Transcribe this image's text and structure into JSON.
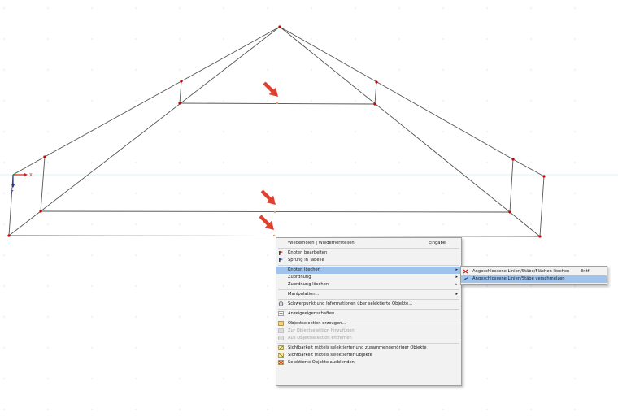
{
  "axis": {
    "x_label": "X",
    "z_label": "Z"
  },
  "colors": {
    "member": "#555555",
    "node": "#cc0000",
    "axis_x": "#cc2222",
    "axis_y": "#2a9a3a",
    "axis_z": "#2233aa",
    "arrow": "#e04030",
    "highlight": "#9fc3ec"
  },
  "context_menu": {
    "items": [
      {
        "label": "Wiederholen | Wiederherstellen",
        "shortcut": "Eingabe",
        "icon": ""
      },
      {
        "sep": true
      },
      {
        "label": "Knoten bearbeiten",
        "icon": "edit-node-icon"
      },
      {
        "label": "Sprung in Tabelle",
        "icon": "jump-table-icon"
      },
      {
        "sep": true
      },
      {
        "label": "Knoten löschen",
        "submenu": true,
        "highlighted": true
      },
      {
        "label": "Zuordnung",
        "submenu": true
      },
      {
        "label": "Zuordnung löschen",
        "submenu": true
      },
      {
        "sep": true
      },
      {
        "label": "Manipulation...",
        "submenu": true
      },
      {
        "sep": true
      },
      {
        "label": "Schwerpunkt und Informationen über selektierte Objekte...",
        "icon": "centroid-info-icon"
      },
      {
        "sep": true
      },
      {
        "label": "Anzeigeeigenschaften...",
        "icon": "display-properties-icon"
      },
      {
        "sep": true
      },
      {
        "label": "Objektselektion erzeugen...",
        "icon": "object-selection-create-icon"
      },
      {
        "label": "Zur Objektselektion hinzufügen",
        "icon": "object-selection-add-icon",
        "disabled": true
      },
      {
        "label": "Aus Objektselektion entfernen",
        "icon": "object-selection-remove-icon",
        "disabled": true
      },
      {
        "sep": true
      },
      {
        "label": "Sichtbarkeit mittels selektierter und zusammengehöriger Objekte",
        "icon": "visibility-related-icon"
      },
      {
        "label": "Sichtbarkeit mittels selektierter Objekte",
        "icon": "visibility-selected-icon"
      },
      {
        "label": "Selektierte Objekte ausblenden",
        "icon": "hide-selected-icon"
      }
    ]
  },
  "submenu": {
    "items": [
      {
        "label": "Angeschlossene Linien/Stäbe/Flächen löschen",
        "shortcut": "Entf",
        "icon": "delete-x-icon"
      },
      {
        "label": "Angeschlossene Linien/Stäbe verschmelzen",
        "icon": "merge-lines-icon",
        "highlighted": true
      }
    ]
  }
}
